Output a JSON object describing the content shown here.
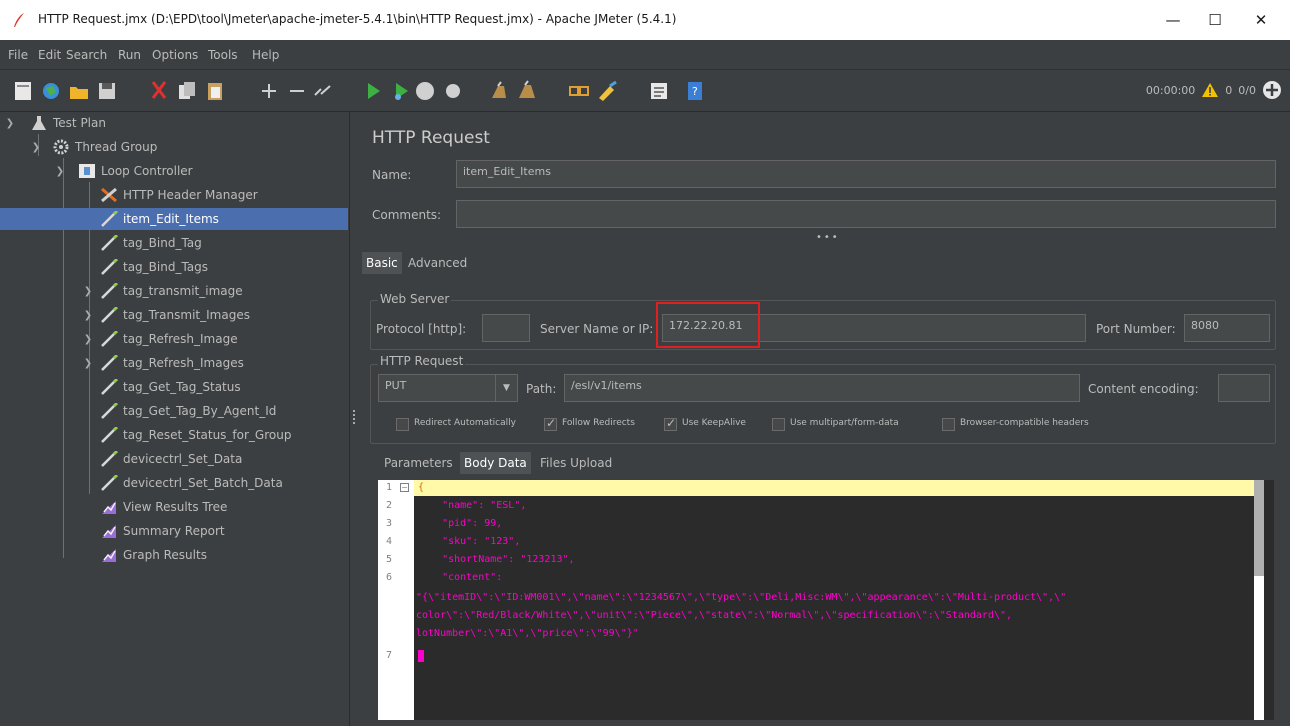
{
  "window": {
    "title": "HTTP Request.jmx (D:\\EPD\\tool\\Jmeter\\apache-jmeter-5.4.1\\bin\\HTTP Request.jmx) - Apache JMeter (5.4.1)",
    "minimize": "—",
    "maximize": "☐",
    "close": "✕"
  },
  "menu": [
    "File",
    "Edit",
    "Search",
    "Run",
    "Options",
    "Tools",
    "Help"
  ],
  "toolbar": {
    "timer": "00:00:00",
    "warnings": "0",
    "threads": "0/0"
  },
  "tree": [
    {
      "label": "Test Plan",
      "icon": "flask-icon"
    },
    {
      "label": "Thread Group",
      "icon": "gear-icon"
    },
    {
      "label": "Loop Controller",
      "icon": "loop-icon"
    },
    {
      "label": "HTTP Header Manager",
      "icon": "tools-icon"
    },
    {
      "label": "item_Edit_Items",
      "icon": "pipette-icon"
    },
    {
      "label": "tag_Bind_Tag",
      "icon": "pipette-icon"
    },
    {
      "label": "tag_Bind_Tags",
      "icon": "pipette-icon"
    },
    {
      "label": "tag_transmit_image",
      "icon": "pipette-icon"
    },
    {
      "label": "tag_Transmit_Images",
      "icon": "pipette-icon"
    },
    {
      "label": "tag_Refresh_Image",
      "icon": "pipette-icon"
    },
    {
      "label": "tag_Refresh_Images",
      "icon": "pipette-icon"
    },
    {
      "label": "tag_Get_Tag_Status",
      "icon": "pipette-icon"
    },
    {
      "label": "tag_Get_Tag_By_Agent_Id",
      "icon": "pipette-icon"
    },
    {
      "label": "tag_Reset_Status_for_Group",
      "icon": "pipette-icon"
    },
    {
      "label": "devicectrl_Set_Data",
      "icon": "pipette-icon"
    },
    {
      "label": "devicectrl_Set_Batch_Data",
      "icon": "pipette-icon"
    },
    {
      "label": "View Results Tree",
      "icon": "chart-icon"
    },
    {
      "label": "Summary Report",
      "icon": "chart-icon"
    },
    {
      "label": "Graph Results",
      "icon": "chart-icon"
    }
  ],
  "panel": {
    "title": "HTTP Request",
    "name_label": "Name:",
    "name_value": "item_Edit_Items",
    "comments_label": "Comments:",
    "comments_value": "",
    "tabs": [
      "Basic",
      "Advanced"
    ],
    "web_server_title": "Web Server",
    "protocol_label": "Protocol [http]:",
    "protocol_value": "",
    "server_label": "Server Name or IP:",
    "server_value": "172.22.20.81",
    "port_label": "Port Number:",
    "port_value": "8080",
    "http_request_title": "HTTP Request",
    "method": "PUT",
    "path_label": "Path:",
    "path_value": "/esl/v1/items",
    "encoding_label": "Content encoding:",
    "encoding_value": "",
    "checkboxes": [
      {
        "label": "Redirect Automatically",
        "checked": false
      },
      {
        "label": "Follow Redirects",
        "checked": true
      },
      {
        "label": "Use KeepAlive",
        "checked": true
      },
      {
        "label": "Use multipart/form-data",
        "checked": false
      },
      {
        "label": "Browser-compatible headers",
        "checked": false
      }
    ],
    "body_tabs": [
      "Parameters",
      "Body Data",
      "Files Upload"
    ]
  },
  "editor": {
    "line_numbers": [
      "1",
      "2",
      "3",
      "4",
      "5",
      "6",
      "7"
    ],
    "lines": [
      "{",
      "    \"name\": \"ESL\",",
      "    \"pid\": 99,",
      "    \"sku\": \"123\",",
      "    \"shortName\": \"123213\",",
      "    \"content\":",
      "\"{\\\"itemID\\\":\\\"ID:WM001\\\",\\\"name\\\":\\\"1234567\\\",\\\"type\\\":\\\"Deli,Misc:WM\\\",\\\"appearance\\\":\\\"Multi-product\\\",\\\"",
      "color\\\":\\\"Red/Black/White\\\",\\\"unit\\\":\\\"Piece\\\",\\\"state\\\":\\\"Normal\\\",\\\"specification\\\":\\\"Standard\\\",",
      "lotNumber\\\":\\\"A1\\\",\\\"price\\\":\\\"99\\\"}\""
    ]
  }
}
